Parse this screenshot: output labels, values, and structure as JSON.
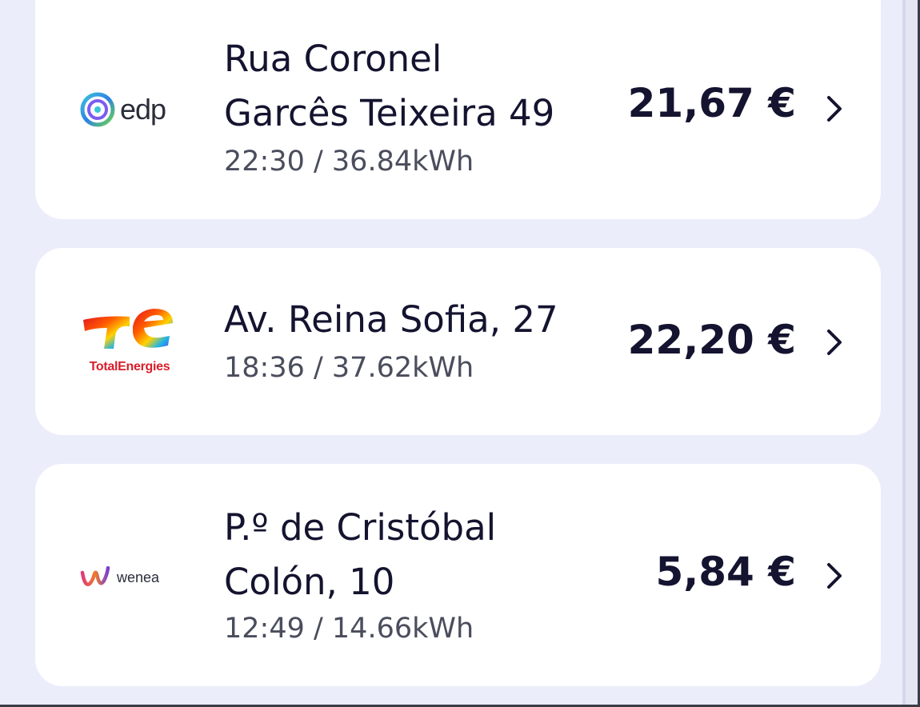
{
  "charges": [
    {
      "provider": "edp",
      "provider_icon": "edp-logo-icon",
      "address": "Rua Coronel Garcês Teixeira 49",
      "address_line1": "Rua Coronel",
      "address_line2": "Garcês Teixeira 49",
      "details": "22:30 / 36.84kWh",
      "price": "21,67 €"
    },
    {
      "provider": "TotalEnergies",
      "provider_icon": "totalenergies-logo-icon",
      "address": "Av. Reina Sofia, 27",
      "address_line1": "Av. Reina Sofia, 27",
      "details": "18:36 / 37.62kWh",
      "price": "22,20 €"
    },
    {
      "provider": "wenea",
      "provider_icon": "wenea-logo-icon",
      "address": "P.º de Cristóbal Colón, 10",
      "address_line1": "P.º de Cristóbal",
      "address_line2": "Colón, 10",
      "details": "12:49 / 14.66kWh",
      "price": "5,84 €"
    }
  ],
  "icons": {
    "chevron": "chevron-right-icon"
  },
  "colors": {
    "background": "#ecedfb",
    "card": "#ffffff",
    "text_primary": "#141430",
    "text_secondary": "#4a4d5c"
  }
}
